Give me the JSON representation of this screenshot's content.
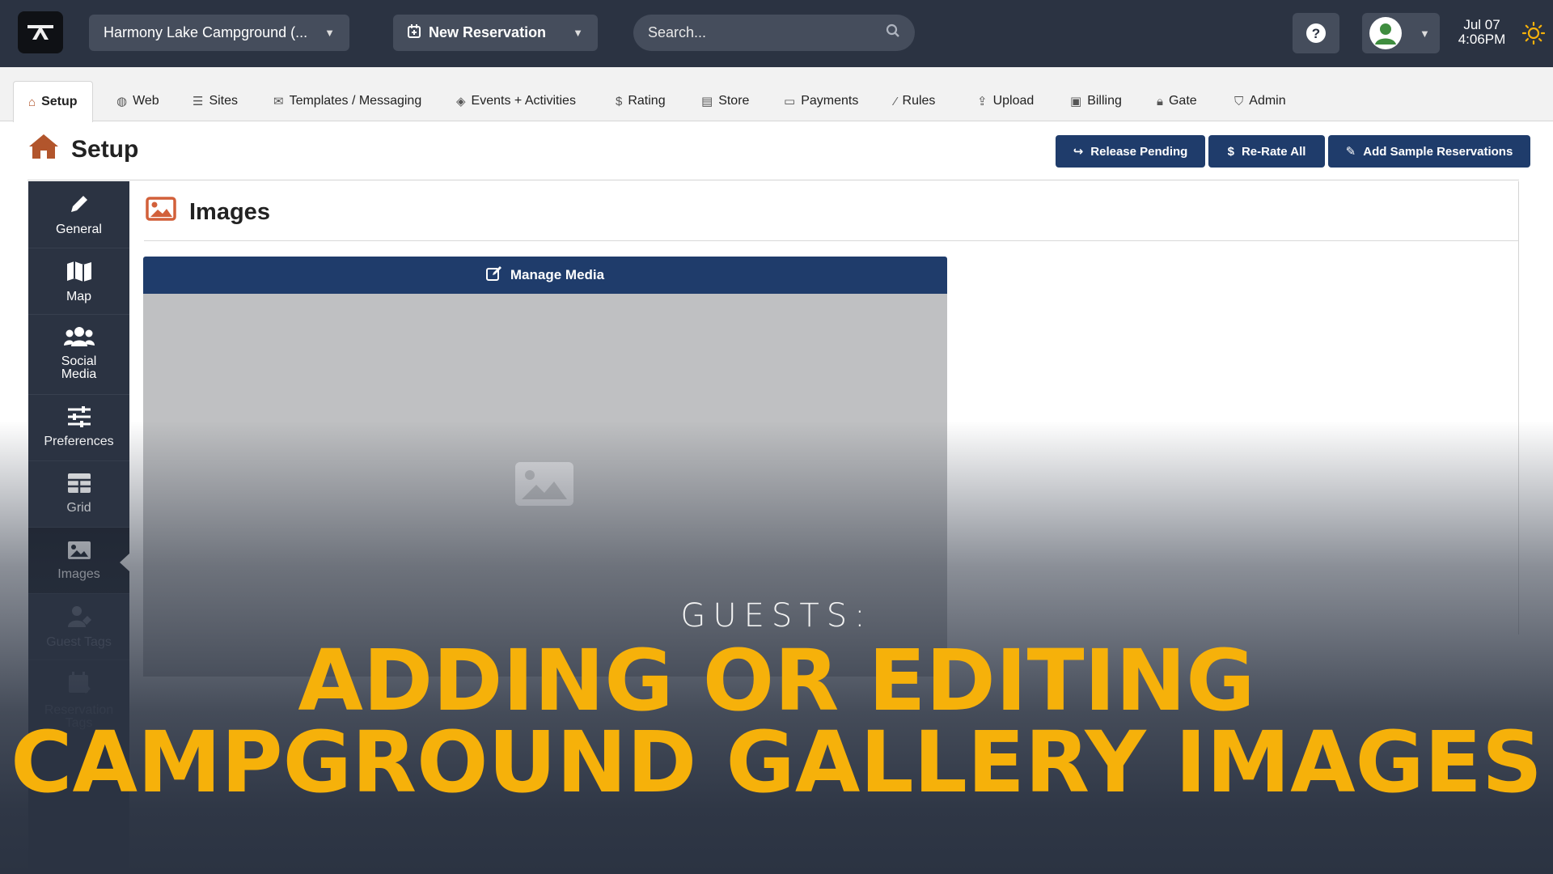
{
  "topbar": {
    "campground_label": "Harmony Lake Campground (...",
    "new_reservation_label": "New Reservation",
    "search_placeholder": "Search...",
    "date": "Jul 07",
    "time": "4:06PM"
  },
  "tabs": [
    {
      "label": "Setup",
      "icon": "home-icon"
    },
    {
      "label": "Web",
      "icon": "globe-icon"
    },
    {
      "label": "Sites",
      "icon": "list-icon"
    },
    {
      "label": "Templates / Messaging",
      "icon": "envelope-icon"
    },
    {
      "label": "Events + Activities",
      "icon": "ticket-icon"
    },
    {
      "label": "Rating",
      "icon": "dollar-icon"
    },
    {
      "label": "Store",
      "icon": "store-icon"
    },
    {
      "label": "Payments",
      "icon": "credit-card-icon"
    },
    {
      "label": "Rules",
      "icon": "wand-icon"
    },
    {
      "label": "Upload",
      "icon": "upload-icon"
    },
    {
      "label": "Billing",
      "icon": "billing-icon"
    },
    {
      "label": "Gate",
      "icon": "lock-icon"
    },
    {
      "label": "Admin",
      "icon": "shield-icon"
    }
  ],
  "page": {
    "title": "Setup",
    "actions": {
      "release_pending": "Release Pending",
      "rerate_all": "Re-Rate All",
      "add_sample": "Add Sample Reservations"
    }
  },
  "sidebar": {
    "items": [
      {
        "label": "General",
        "icon": "pencil-icon"
      },
      {
        "label": "Map",
        "icon": "map-icon"
      },
      {
        "label": "Social Media",
        "icon": "users-icon"
      },
      {
        "label": "Preferences",
        "icon": "sliders-icon"
      },
      {
        "label": "Grid",
        "icon": "grid-icon"
      },
      {
        "label": "Images",
        "icon": "image-icon"
      },
      {
        "label": "Guest Tags",
        "icon": "user-tag-icon"
      },
      {
        "label": "Reservation Tags",
        "icon": "calendar-tag-icon"
      }
    ]
  },
  "section": {
    "title": "Images",
    "manage_media_label": "Manage Media"
  },
  "overlay": {
    "kicker": "GUESTS:",
    "headline_line1": "ADDING OR EDITING",
    "headline_line2": "CAMPGROUND GALLERY IMAGES"
  },
  "colors": {
    "navbar": "#2b3342",
    "primary_button": "#1f3c6b",
    "accent": "#b2552c",
    "headline": "#f6b10a"
  }
}
